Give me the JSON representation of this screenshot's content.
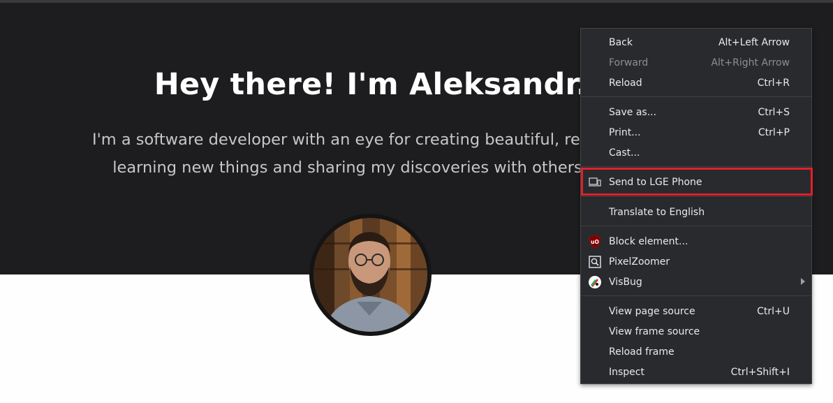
{
  "hero": {
    "title": "Hey there! I'm Aleksandr.",
    "line1": "I'm a software developer with an eye for creating beautiful, responsive",
    "line2": "learning new things and sharing my discoveries with others throu"
  },
  "avatar": {
    "icon": "profile-photo"
  },
  "context_menu": {
    "back": {
      "label": "Back",
      "shortcut": "Alt+Left Arrow"
    },
    "forward": {
      "label": "Forward",
      "shortcut": "Alt+Right Arrow",
      "disabled": true
    },
    "reload": {
      "label": "Reload",
      "shortcut": "Ctrl+R"
    },
    "save_as": {
      "label": "Save as...",
      "shortcut": "Ctrl+S"
    },
    "print": {
      "label": "Print...",
      "shortcut": "Ctrl+P"
    },
    "cast": {
      "label": "Cast..."
    },
    "send_to_device": {
      "label": "Send to LGE Phone",
      "icon": "devices-icon"
    },
    "translate": {
      "label": "Translate to English"
    },
    "block_element": {
      "label": "Block element...",
      "icon": "ublock-origin-icon"
    },
    "pixelzoomer": {
      "label": "PixelZoomer",
      "icon": "pixelzoomer-icon"
    },
    "visbug": {
      "label": "VisBug",
      "icon": "visbug-icon",
      "has_submenu": true
    },
    "view_page_source": {
      "label": "View page source",
      "shortcut": "Ctrl+U"
    },
    "view_frame_source": {
      "label": "View frame source"
    },
    "reload_frame": {
      "label": "Reload frame"
    },
    "inspect": {
      "label": "Inspect",
      "shortcut": "Ctrl+Shift+I"
    }
  },
  "colors": {
    "hero_bg": "#1d1d1f",
    "menu_bg": "#292a2d",
    "highlight": "#e0202a"
  }
}
